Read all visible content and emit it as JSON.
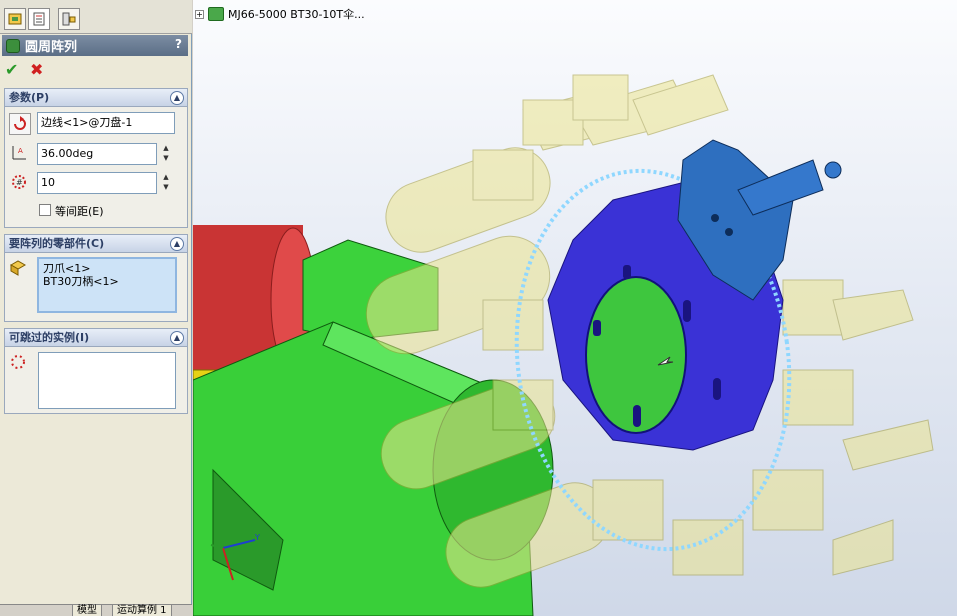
{
  "property_manager": {
    "tab_icons": [
      "feature-manager-icon",
      "property-manager-icon",
      "configuration-manager-icon"
    ],
    "title": "圆周阵列",
    "help_label": "?",
    "ok_label": "✔",
    "cancel_label": "✖",
    "parameters": {
      "title": "参数(P)",
      "axis_value": "边线<1>@刀盘-1",
      "angle_value": "36.00deg",
      "instances_value": "10",
      "equal_spacing_label": "等间距(E)",
      "equal_spacing_checked": false
    },
    "features_to_pattern": {
      "title": "要阵列的零部件(C)",
      "items": [
        "刀爪<1>",
        "BT30刀柄<1>"
      ]
    },
    "instances_to_skip": {
      "title": "可跳过的实例(I)",
      "items": []
    },
    "bottom_tabs": [
      "模型",
      "运动算例 1"
    ]
  },
  "viewport": {
    "tree_root": "MJ66-5000 BT30-10T伞..."
  },
  "colors": {
    "header_bg": "#6b7d96",
    "group_title": "#2d3f65",
    "disc": "#3a32d6",
    "green_block": "#3cd23c",
    "red_cylinder": "#d83a3a",
    "tool_holder_blue": "#2e6fbf",
    "transparent_tools": "#e8e08a"
  }
}
